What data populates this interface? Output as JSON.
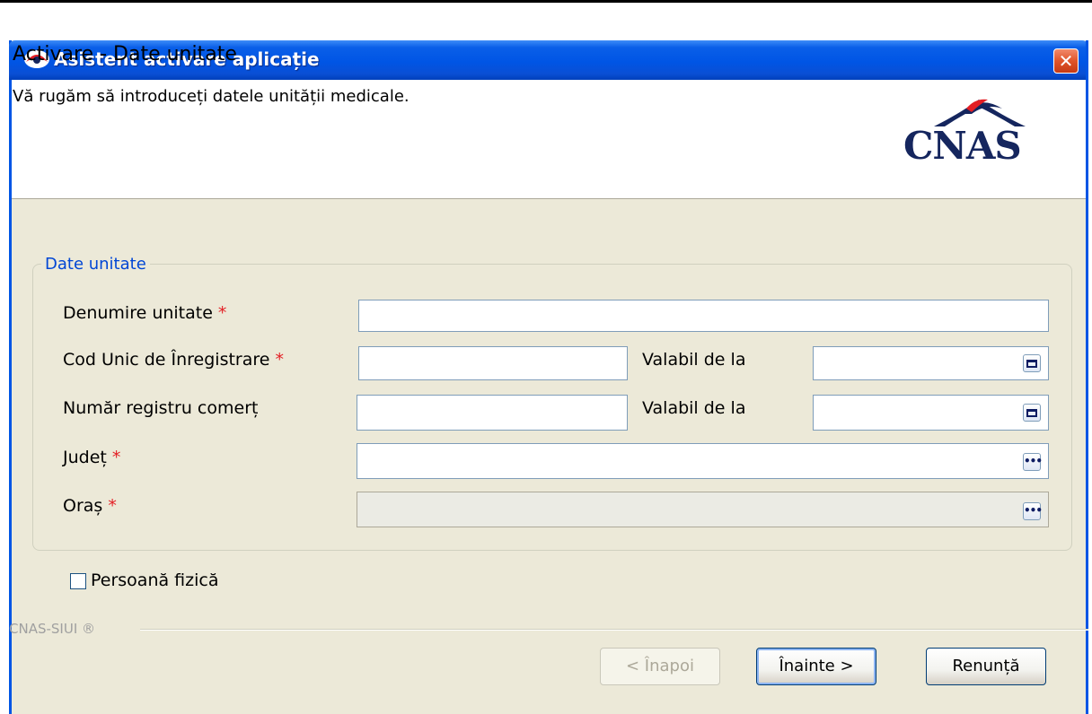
{
  "window": {
    "title": "Asistent activare aplicație",
    "close_label": "✕"
  },
  "header": {
    "title": "Activare - Date unitate",
    "subtitle": "Vă rugăm să introduceți datele unității medicale.",
    "logo_text": "CNAS"
  },
  "group": {
    "legend": "Date unitate"
  },
  "form": {
    "required_marker": "*",
    "fields": [
      {
        "label": "Denumire unitate",
        "required": true,
        "value": ""
      },
      {
        "label": "Cod Unic de Înregistrare",
        "required": true,
        "value": ""
      },
      {
        "label": "Număr registru comerț",
        "required": false,
        "value": ""
      },
      {
        "label": "Județ",
        "required": true,
        "value": ""
      },
      {
        "label": "Oraș",
        "required": true,
        "value": "",
        "disabled": true
      }
    ],
    "valid_from_label": "Valabil de la",
    "valid_from_values": [
      "",
      ""
    ]
  },
  "checkbox": {
    "label": "Persoană fizică",
    "checked": false
  },
  "footer": {
    "separator_text": "CNAS-SIUI ®",
    "back_label": "< Înapoi",
    "next_label": "Înainte >",
    "cancel_label": "Renunță"
  },
  "colors": {
    "titlebar": "#0055e5",
    "required": "#e31e24",
    "legend": "#0046d5",
    "logo": "#15265e"
  },
  "icons": {
    "app": "cnas-logo-icon",
    "calendar": "calendar-icon",
    "browse": "ellipsis-icon"
  }
}
